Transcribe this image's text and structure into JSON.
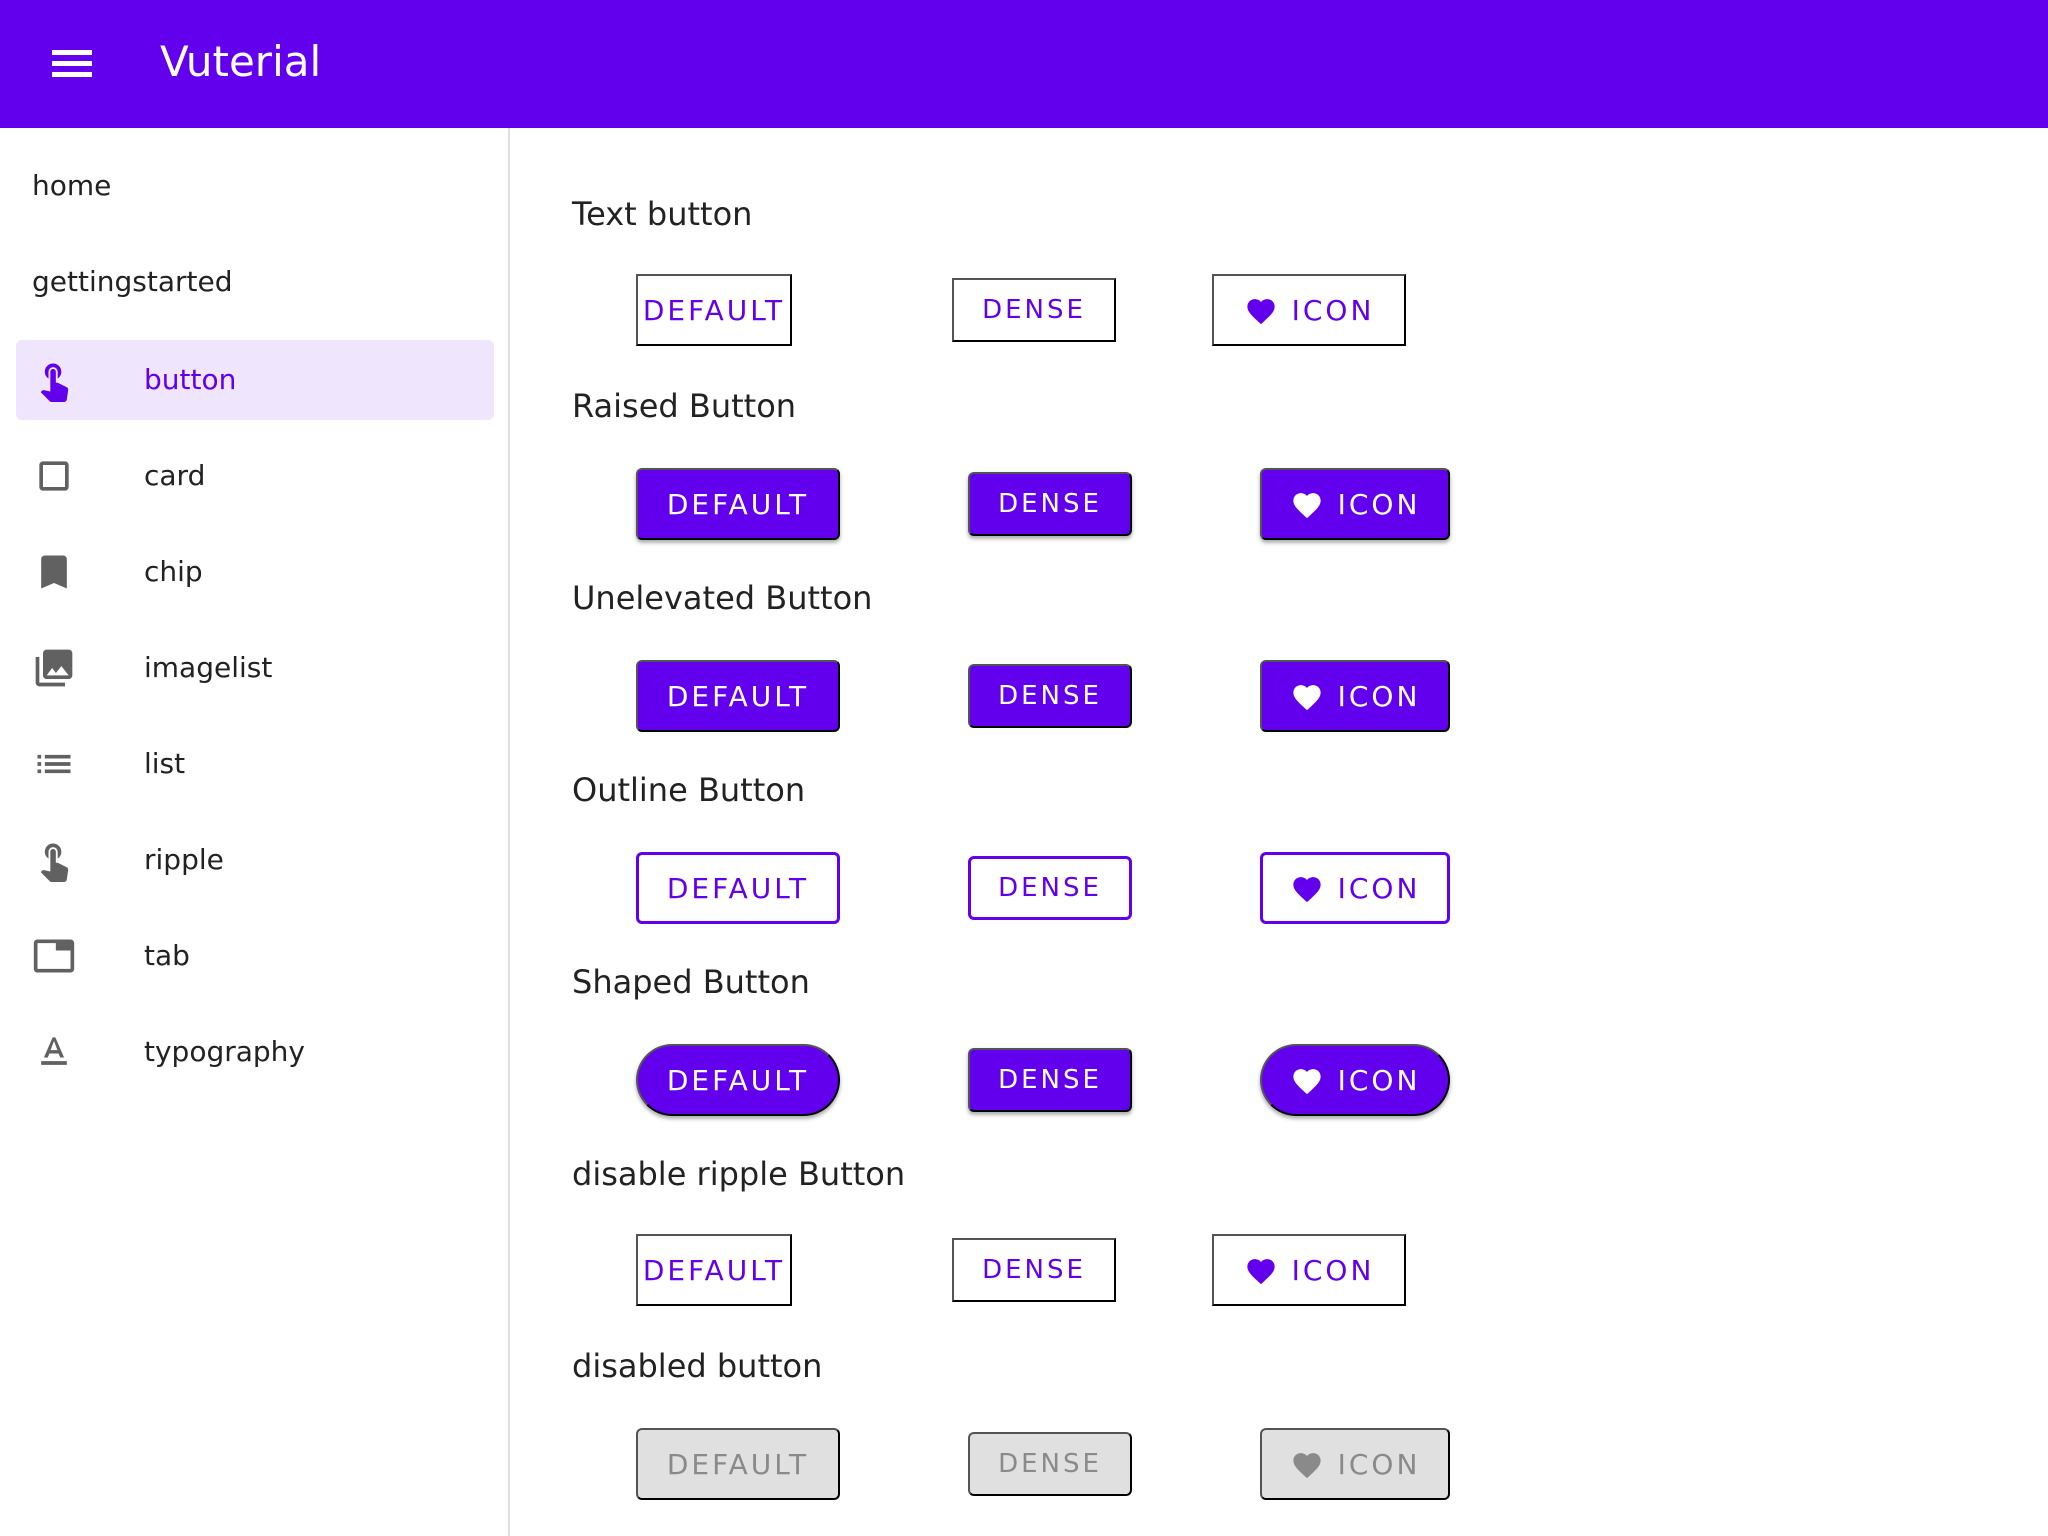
{
  "app": {
    "title": "Vuterial",
    "menu_icon": "menu-icon",
    "primary_color": "#6200ee"
  },
  "drawer": {
    "items": [
      {
        "label": "home",
        "icon": ""
      },
      {
        "label": "gettingstarted",
        "icon": ""
      },
      {
        "label": "button",
        "icon": "touch-app-icon",
        "active": true
      },
      {
        "label": "card",
        "icon": "crop-square-icon"
      },
      {
        "label": "chip",
        "icon": "bookmark-icon"
      },
      {
        "label": "imagelist",
        "icon": "photo-library-icon"
      },
      {
        "label": "list",
        "icon": "list-icon"
      },
      {
        "label": "ripple",
        "icon": "touch-app-icon"
      },
      {
        "label": "tab",
        "icon": "tab-icon"
      },
      {
        "label": "typography",
        "icon": "text-format-icon"
      }
    ]
  },
  "sections": [
    {
      "title": "Text button",
      "variant": "text",
      "buttons": {
        "default": "DEFAULT",
        "dense": "DENSE",
        "icon": "ICON"
      }
    },
    {
      "title": "Raised Button",
      "variant": "raised",
      "buttons": {
        "default": "DEFAULT",
        "dense": "DENSE",
        "icon": "ICON"
      }
    },
    {
      "title": "Unelevated Button",
      "variant": "unelevated",
      "buttons": {
        "default": "DEFAULT",
        "dense": "DENSE",
        "icon": "ICON"
      }
    },
    {
      "title": "Outline Button",
      "variant": "outline",
      "buttons": {
        "default": "DEFAULT",
        "dense": "DENSE",
        "icon": "ICON"
      }
    },
    {
      "title": "Shaped Button",
      "variant": "shaped",
      "buttons": {
        "default": "DEFAULT",
        "dense": "DENSE",
        "icon": "ICON"
      }
    },
    {
      "title": "disable ripple Button",
      "variant": "text",
      "buttons": {
        "default": "DEFAULT",
        "dense": "DENSE",
        "icon": "ICON"
      }
    },
    {
      "title": "disabled button",
      "variant": "disabled",
      "buttons": {
        "default": "DEFAULT",
        "dense": "DENSE",
        "icon": "ICON"
      }
    }
  ]
}
